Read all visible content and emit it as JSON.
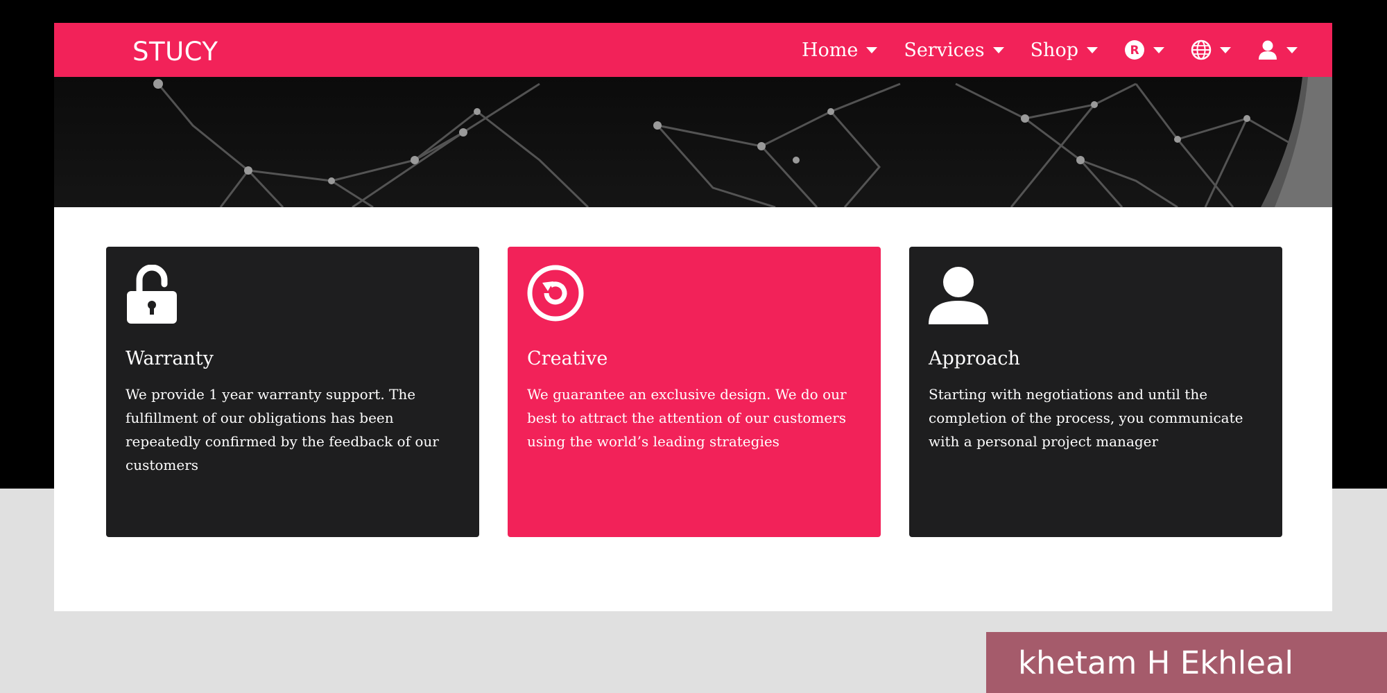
{
  "brand": "STUCY",
  "nav": {
    "items": [
      {
        "label": "Home"
      },
      {
        "label": "Services"
      },
      {
        "label": "Shop"
      }
    ],
    "icons": [
      "registered-icon",
      "globe-icon",
      "user-icon"
    ]
  },
  "hero": {
    "image": "network-lines-background"
  },
  "features": [
    {
      "icon": "unlock-icon",
      "title": "Warranty",
      "text": "We provide 1 year warranty support. The fulfillment of our obligations has been repeatedly confirmed by the feedback of our customers"
    },
    {
      "icon": "refresh-circle-icon",
      "title": "Creative",
      "text": "We guarantee an exclusive design. We do our best to attract the attention of our customers using the world’s leading strategies"
    },
    {
      "icon": "user-icon",
      "title": "Approach",
      "text": "Starting with negotiations and until the completion of the process, you communicate with a personal project manager"
    }
  ],
  "watermark": "khetam H Ekhleal",
  "colors": {
    "accent": "#f22259",
    "card_dark": "#1e1e1f",
    "watermark_bg": "#a55b6b"
  }
}
